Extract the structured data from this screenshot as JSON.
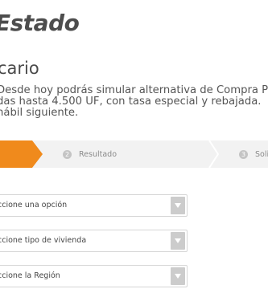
{
  "header": {
    "logo_text": "Estado"
  },
  "main": {
    "title": "cario",
    "intro_lines": [
      "Desde hoy podrás simular alternativa de Compra Pr",
      "das hasta 4.500 UF, con tasa especial y rebajada.",
      "hábil siguiente."
    ]
  },
  "stepper": {
    "steps": [
      {
        "number": "2",
        "label": "Resultado"
      },
      {
        "number": "3",
        "label": "Soli"
      }
    ],
    "colors": {
      "active": "#f08a1c",
      "inactive_bg": "#f2f2f2"
    }
  },
  "form": {
    "selects": [
      {
        "value": "ccione una opción"
      },
      {
        "value": "ccione tipo de vivienda"
      },
      {
        "value": "ccione la Región"
      }
    ]
  },
  "icons": {
    "select_arrow": "chevron-down-icon"
  }
}
